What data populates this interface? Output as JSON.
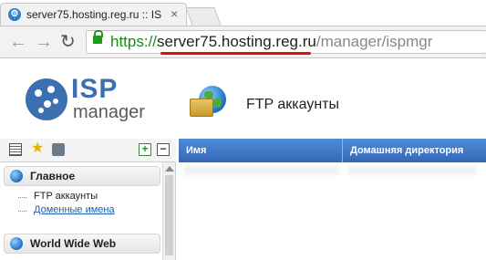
{
  "browser": {
    "tab": {
      "title": "server75.hosting.reg.ru :: IS"
    },
    "url": {
      "scheme": "https://",
      "host": "server75.hosting.reg.ru",
      "path": "/manager/ispmgr"
    }
  },
  "app": {
    "logo": {
      "brand": "ISP",
      "product": "manager"
    },
    "page_title": "FTP аккаунты"
  },
  "sidebar": {
    "groups": [
      {
        "label": "Главное",
        "icon": "globe-icon",
        "items": [
          {
            "label": "FTP аккаунты"
          },
          {
            "label": "Доменные имена"
          }
        ]
      },
      {
        "label": "World Wide Web",
        "icon": "globe-icon",
        "items": []
      }
    ]
  },
  "table": {
    "columns": [
      {
        "label": "Имя"
      },
      {
        "label": "Домашняя директория"
      }
    ]
  },
  "colors": {
    "header_blue": "#3468b8",
    "link": "#1a5fb0",
    "https_green": "#1a8a1a",
    "annotation_red": "#e01010"
  }
}
